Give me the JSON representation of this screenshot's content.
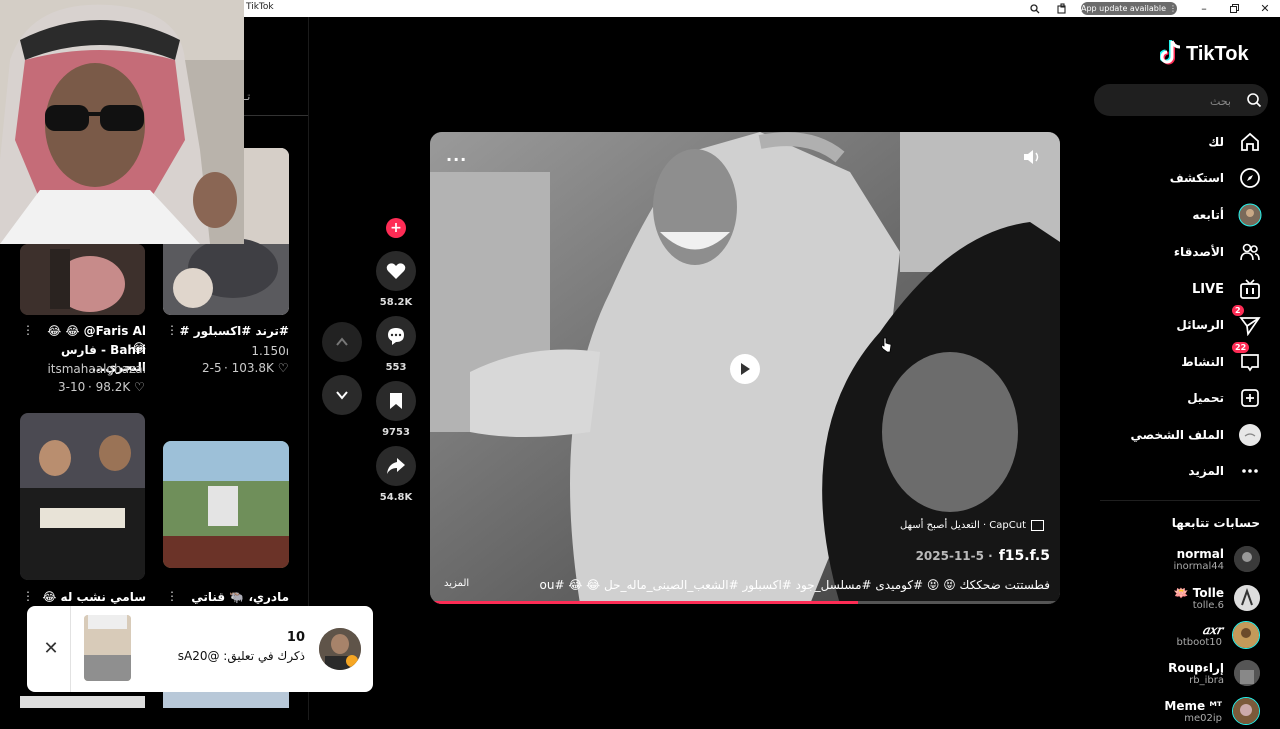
{
  "window": {
    "title": "TikTok",
    "update_label": "App update available"
  },
  "left_panel": {
    "tab_fragment": "تـ",
    "videos": [
      {
        "title_line1": "Faris Al@ 😂 😂 😂",
        "title_line2": "Bahri - فارس البحري...",
        "author": "itsmahaalghazal",
        "date": "3-10",
        "likes": "98.2K"
      },
      {
        "title_line1": "#ترند #اكسبلور #",
        "title_line2": "",
        "author": "ו1.150",
        "date": "2-5",
        "likes": "103.8K"
      },
      {
        "title_line1": "سامي نشب له 😂 😂 !",
        "title_line2": "",
        "author": "",
        "date": "",
        "likes": ""
      },
      {
        "title_line1": "مادري، 🐃 قناتي الثاني",
        "title_line2": "",
        "author": "",
        "date": "",
        "likes": ""
      }
    ]
  },
  "notification": {
    "count": "10",
    "text": "ذكرك في تعليق: @sA20"
  },
  "action_rail": {
    "likes": "58.2K",
    "comments": "553",
    "saves": "9753",
    "shares": "54.8K"
  },
  "video": {
    "brand_badge": "CapCut · التعديل أصبح أسهل",
    "author": "f15.f.5",
    "date": "2025-11-5 ·",
    "caption": "فطستتت ضحككك 😝 😝 #كوميدى #مسلسل_جود #اكسبلور #الشعب_الصينى_ماله_حل 😂 😂 #foryou",
    "more_label": "المزيد",
    "progress": 0.68
  },
  "sidebar": {
    "logo_text": "TikTok",
    "search_placeholder": "بحث",
    "items": [
      {
        "label": "لك",
        "icon": "home-icon"
      },
      {
        "label": "استكشف",
        "icon": "compass-icon"
      },
      {
        "label": "أتابعه",
        "icon": "avatar-icon"
      },
      {
        "label": "الأصدقاء",
        "icon": "friends-icon"
      },
      {
        "label": "LIVE",
        "icon": "live-icon"
      },
      {
        "label": "الرسائل",
        "icon": "messages-icon",
        "badge": "2"
      },
      {
        "label": "النشاط",
        "icon": "activity-icon",
        "badge": "22"
      },
      {
        "label": "تحميل",
        "icon": "upload-icon"
      },
      {
        "label": "الملف الشخصي",
        "icon": "profile-icon"
      },
      {
        "label": "المزيد",
        "icon": "more-icon"
      }
    ],
    "following_title": "حسابات تتابعها",
    "following": [
      {
        "name": "normal",
        "handle": "inormal44"
      },
      {
        "name": "🪷 Tolle",
        "handle": "tolle.6"
      },
      {
        "name": "𝑎𝑥𝑟",
        "handle": "btboot10"
      },
      {
        "name": "Roupإراء",
        "handle": "rb_ibra"
      },
      {
        "name": "Meme ᴹᵀ",
        "handle": "me02ip"
      }
    ]
  },
  "colors": {
    "accent": "#fe2c55",
    "bg": "#000000",
    "tiktok_cyan": "#25f4ee"
  }
}
